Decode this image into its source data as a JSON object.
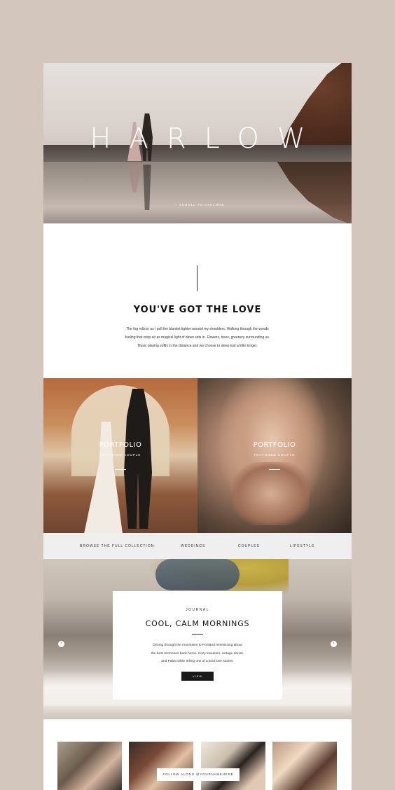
{
  "hero": {
    "title": "HARLOW",
    "scroll_label": "+ SCROLL TO EXPLORE"
  },
  "intro": {
    "title": "YOU'VE GOT THE LOVE",
    "body_line1": "The fog rolls in as I pull the blanket tighter around my shoulders. Walking through the woods",
    "body_line2": "feeling that crisp air as magical light of dawn sets in. Flowers, trees, greenery surrounding us.",
    "body_line3": "Music playing softly in the distance and we choose to sleep just a little longer."
  },
  "portfolio": {
    "cards": [
      {
        "label": "PORTFOLIO",
        "sub": "FEATURED COUPLE"
      },
      {
        "label": "PORTFOLIO",
        "sub": "FEATURED COUPLE"
      }
    ]
  },
  "browse": {
    "label": "BROWSE THE FULL COLLECTION:",
    "links": [
      "WEDDINGS",
      "COUPLES",
      "LIFESTYLE"
    ]
  },
  "journal": {
    "kicker": "JOURNAL",
    "title": "COOL, CALM MORNINGS",
    "body_line1": "Driving through the mountains to Portland reminiscing about",
    "body_line2": "the best memories back home. Cozy sweaters, vintage denim,",
    "body_line3": "and Pabst while telling one of a kind love stories.",
    "button": "VIEW",
    "arrow_left": "‹",
    "arrow_right": "›"
  },
  "instagram": {
    "follow_label": "FOLLOW ALONG @YOURNAMEHERE"
  },
  "colors": {
    "background": "#d3c6bd",
    "bar": "#efefef",
    "button": "#1a1a1a"
  }
}
